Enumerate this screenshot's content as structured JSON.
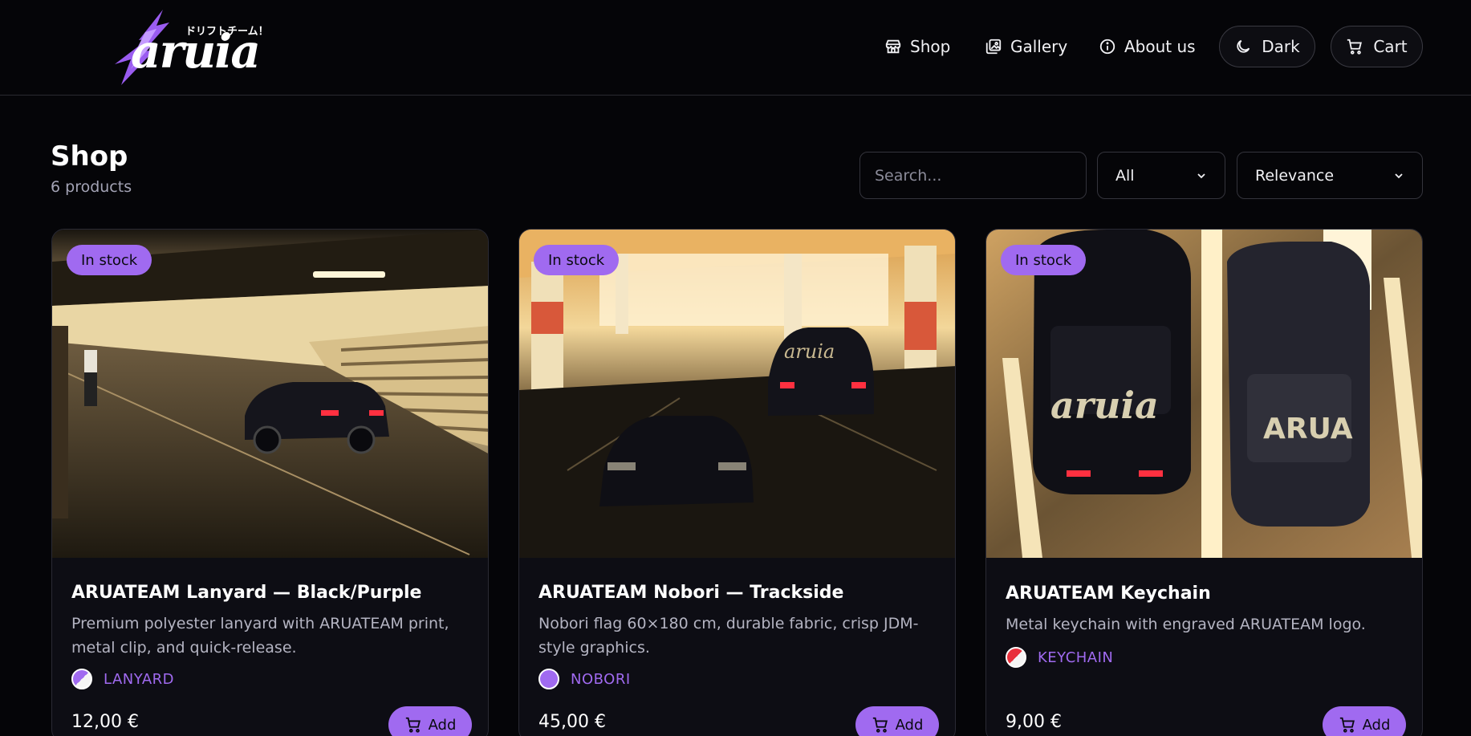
{
  "brand": {
    "logo_word": "aruia",
    "logo_tagline": "ドリフトチーム！",
    "accent": "#a06af0"
  },
  "nav": {
    "shop": "Shop",
    "gallery": "Gallery",
    "about": "About us",
    "theme": "Dark",
    "cart": "Cart"
  },
  "shop": {
    "title": "Shop",
    "count": "6 products",
    "search_placeholder": "Search...",
    "filter_selected": "All",
    "sort_selected": "Relevance"
  },
  "products": [
    {
      "badge": "In stock",
      "title": "ARUATEAM Lanyard — Black/Purple",
      "description": "Premium polyester lanyard with ARUATEAM print, metal clip, and quick-release.",
      "category": "LANYARD",
      "swatch": "half-purple-white",
      "price": "12,00 €",
      "add_label": "Add"
    },
    {
      "badge": "In stock",
      "title": "ARUATEAM Nobori — Trackside",
      "description": "Nobori flag 60×180 cm, durable fabric, crisp JDM-style graphics.",
      "category": "NOBORI",
      "swatch": "solid-purple",
      "price": "45,00 €",
      "add_label": "Add"
    },
    {
      "badge": "In stock",
      "title": "ARUATEAM Keychain",
      "description": "Metal keychain with engraved ARUATEAM logo.",
      "category": "KEYCHAIN",
      "swatch": "half-red-white",
      "price": "9,00 €",
      "add_label": "Add"
    }
  ]
}
